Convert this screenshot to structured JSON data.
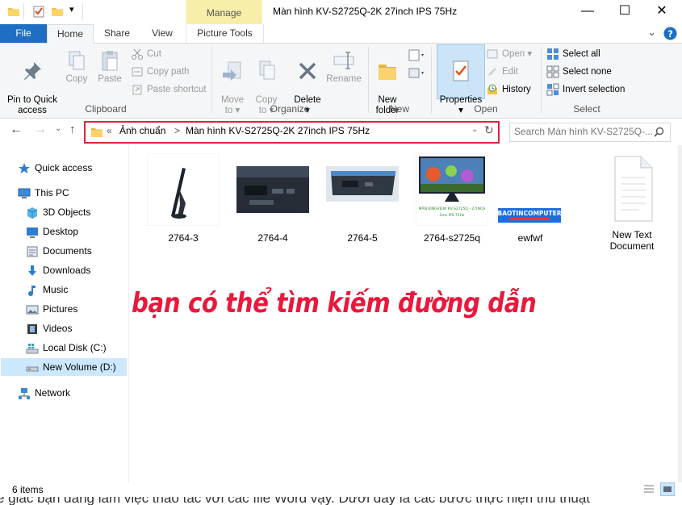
{
  "window": {
    "title": "Màn hình KV-S2725Q-2K 27inch IPS 75Hz",
    "context_tab": "Manage",
    "controls": [
      "—",
      "☐",
      "✕"
    ]
  },
  "ribbon_tabs": {
    "file": "File",
    "home": "Home",
    "share": "Share",
    "view": "View",
    "picture_tools": "Picture Tools"
  },
  "ribbon": {
    "clipboard": {
      "label": "Clipboard",
      "pin": "Pin to Quick\naccess",
      "copy": "Copy",
      "paste": "Paste",
      "cut": "Cut",
      "copy_path": "Copy path",
      "paste_shortcut": "Paste shortcut"
    },
    "organize": {
      "label": "Organize",
      "move_to": "Move\nto ▾",
      "copy_to": "Copy\nto ▾",
      "delete": "Delete\n▾",
      "rename": "Rename"
    },
    "new": {
      "label": "New",
      "new_folder": "New\nfolder"
    },
    "open": {
      "label": "Open",
      "properties": "Properties\n▾",
      "open": "Open ▾",
      "edit": "Edit",
      "history": "History"
    },
    "select": {
      "label": "Select",
      "select_all": "Select all",
      "select_none": "Select none",
      "invert": "Invert selection"
    }
  },
  "address": {
    "chevrons": "«",
    "crumb1": "Ảnh chuẩn",
    "sep": ">",
    "crumb2": "Màn hình KV-S2725Q-2K 27inch IPS 75Hz",
    "search_placeholder": "Search Màn hình KV-S2725Q-..."
  },
  "sidebar": {
    "quick_access": "Quick access",
    "this_pc": "This PC",
    "objects3d": "3D Objects",
    "desktop": "Desktop",
    "documents": "Documents",
    "downloads": "Downloads",
    "music": "Music",
    "pictures": "Pictures",
    "videos": "Videos",
    "local_disk": "Local Disk (C:)",
    "new_volume": "New Volume (D:)",
    "network": "Network"
  },
  "files": [
    {
      "name": "2764-3"
    },
    {
      "name": "2764-4"
    },
    {
      "name": "2764-5"
    },
    {
      "name": "2764-s2725q",
      "thumb_text": "MÀN KINGVIEW KV-S2725Q - 27INCH · 2ms · IPS · 75Hz"
    },
    {
      "name": "ewfwf",
      "thumb_text": "BAOTINCOMPUTER"
    },
    {
      "name": "New Text\nDocument"
    }
  ],
  "overlay_text": "bạn có thể tìm kiếm đường dẫn",
  "status": {
    "items": "6 items"
  },
  "bottom_cut_text": "e giác bạn đang làm việc thao tác với các file Word vậy. Dưới đây là các bước thực hiện thủ thuật",
  "colors": {
    "accent": "#1e6fc3",
    "highlight_red": "#e0213d",
    "manage_tab": "#f7eeaa"
  }
}
